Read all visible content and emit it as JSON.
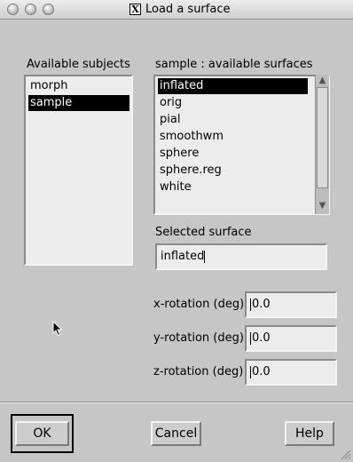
{
  "window": {
    "title": "Load a surface",
    "app_icon": "x-window-icon"
  },
  "subjects": {
    "label": "Available subjects",
    "items": [
      {
        "label": "morph",
        "selected": false
      },
      {
        "label": "sample",
        "selected": true
      }
    ]
  },
  "surfaces": {
    "label": "sample : available surfaces",
    "items": [
      {
        "label": "inflated",
        "selected": true
      },
      {
        "label": "orig",
        "selected": false
      },
      {
        "label": "pial",
        "selected": false
      },
      {
        "label": "smoothwm",
        "selected": false
      },
      {
        "label": "sphere",
        "selected": false
      },
      {
        "label": "sphere.reg",
        "selected": false
      },
      {
        "label": "white",
        "selected": false
      }
    ]
  },
  "selected_surface": {
    "label": "Selected surface",
    "value": "inflated"
  },
  "rotation": {
    "x": {
      "label": "x-rotation (deg)",
      "value": "0.0"
    },
    "y": {
      "label": "y-rotation (deg)",
      "value": "0.0"
    },
    "z": {
      "label": "z-rotation (deg)",
      "value": "0.0"
    }
  },
  "buttons": {
    "ok": "OK",
    "cancel": "Cancel",
    "help": "Help"
  }
}
